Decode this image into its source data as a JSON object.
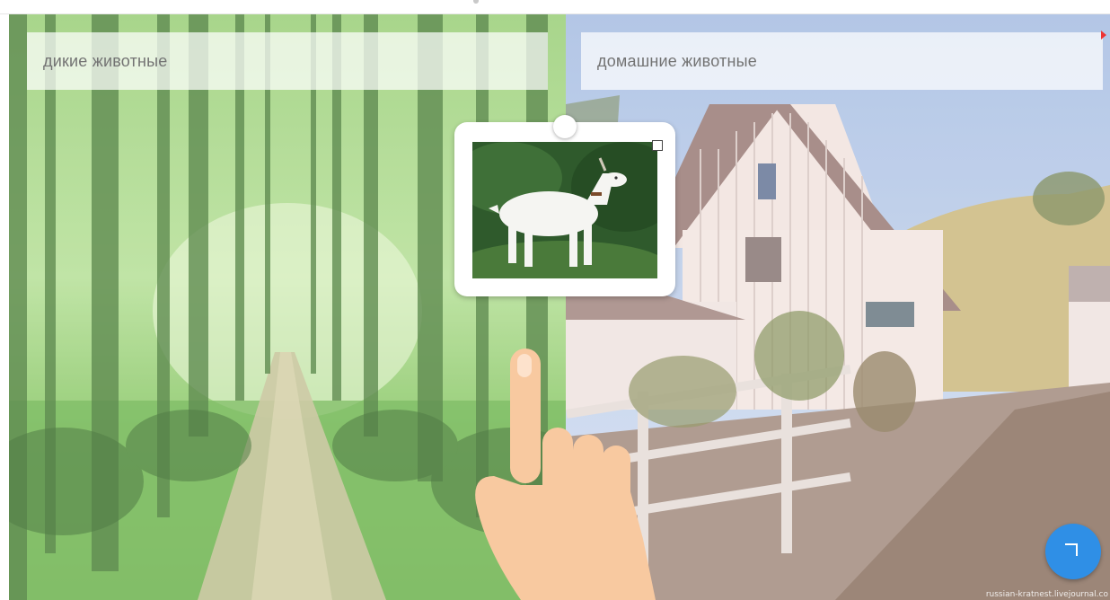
{
  "categories": {
    "left_label": "дикие животные",
    "right_label": "домашние животные"
  },
  "card": {
    "image": "white goat in green grass",
    "expand_icon": "expand-icon"
  },
  "action_button": {
    "icon": "corner-arrow-icon"
  },
  "watermark": "russian-kratnest.livejournal.co",
  "colors": {
    "label_text": "#737373",
    "fab": "#2f8fe6",
    "hand": "#f8c9a0"
  }
}
